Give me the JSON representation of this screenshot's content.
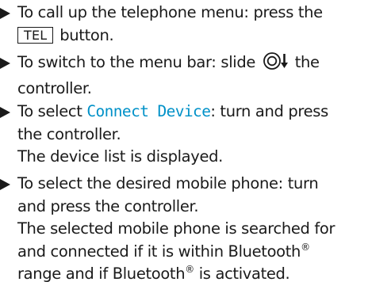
{
  "steps": [
    {
      "lines": [
        "To call up the telephone menu: press the",
        {
          "key": "TEL",
          "after": " button."
        }
      ]
    },
    {
      "lines": [
        {
          "before": "To switch to the menu bar: slide ",
          "after": " the"
        },
        "controller."
      ],
      "icon": "controller-slide-down-icon"
    },
    {
      "lines": [
        {
          "before": "To select ",
          "term": "Connect Device",
          "after": ": turn and press"
        },
        "the controller."
      ],
      "result": [
        "The device list is displayed."
      ]
    },
    {
      "lines": [
        "To select the desired mobile phone: turn",
        "and press the controller."
      ],
      "result": [
        "The selected mobile phone is searched for",
        {
          "before": "and connected if it is within Bluetooth",
          "sup": "®"
        },
        {
          "before": "range and if Bluetooth",
          "sup": "®",
          "after": " is activated."
        }
      ]
    }
  ],
  "colors": {
    "text": "#1a1a1a",
    "menu_term": "#0091c8"
  }
}
